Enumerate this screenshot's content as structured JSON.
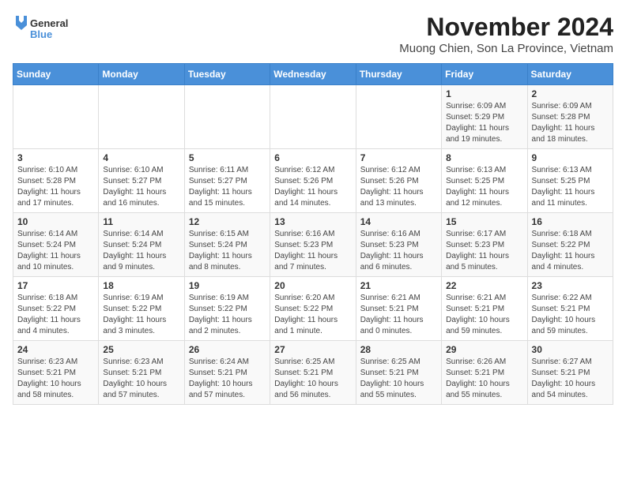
{
  "header": {
    "logo_line1": "General",
    "logo_line2": "Blue",
    "title": "November 2024",
    "subtitle": "Muong Chien, Son La Province, Vietnam"
  },
  "calendar": {
    "days_of_week": [
      "Sunday",
      "Monday",
      "Tuesday",
      "Wednesday",
      "Thursday",
      "Friday",
      "Saturday"
    ],
    "weeks": [
      [
        {
          "day": "",
          "info": ""
        },
        {
          "day": "",
          "info": ""
        },
        {
          "day": "",
          "info": ""
        },
        {
          "day": "",
          "info": ""
        },
        {
          "day": "",
          "info": ""
        },
        {
          "day": "1",
          "info": "Sunrise: 6:09 AM\nSunset: 5:29 PM\nDaylight: 11 hours and 19 minutes."
        },
        {
          "day": "2",
          "info": "Sunrise: 6:09 AM\nSunset: 5:28 PM\nDaylight: 11 hours and 18 minutes."
        }
      ],
      [
        {
          "day": "3",
          "info": "Sunrise: 6:10 AM\nSunset: 5:28 PM\nDaylight: 11 hours and 17 minutes."
        },
        {
          "day": "4",
          "info": "Sunrise: 6:10 AM\nSunset: 5:27 PM\nDaylight: 11 hours and 16 minutes."
        },
        {
          "day": "5",
          "info": "Sunrise: 6:11 AM\nSunset: 5:27 PM\nDaylight: 11 hours and 15 minutes."
        },
        {
          "day": "6",
          "info": "Sunrise: 6:12 AM\nSunset: 5:26 PM\nDaylight: 11 hours and 14 minutes."
        },
        {
          "day": "7",
          "info": "Sunrise: 6:12 AM\nSunset: 5:26 PM\nDaylight: 11 hours and 13 minutes."
        },
        {
          "day": "8",
          "info": "Sunrise: 6:13 AM\nSunset: 5:25 PM\nDaylight: 11 hours and 12 minutes."
        },
        {
          "day": "9",
          "info": "Sunrise: 6:13 AM\nSunset: 5:25 PM\nDaylight: 11 hours and 11 minutes."
        }
      ],
      [
        {
          "day": "10",
          "info": "Sunrise: 6:14 AM\nSunset: 5:24 PM\nDaylight: 11 hours and 10 minutes."
        },
        {
          "day": "11",
          "info": "Sunrise: 6:14 AM\nSunset: 5:24 PM\nDaylight: 11 hours and 9 minutes."
        },
        {
          "day": "12",
          "info": "Sunrise: 6:15 AM\nSunset: 5:24 PM\nDaylight: 11 hours and 8 minutes."
        },
        {
          "day": "13",
          "info": "Sunrise: 6:16 AM\nSunset: 5:23 PM\nDaylight: 11 hours and 7 minutes."
        },
        {
          "day": "14",
          "info": "Sunrise: 6:16 AM\nSunset: 5:23 PM\nDaylight: 11 hours and 6 minutes."
        },
        {
          "day": "15",
          "info": "Sunrise: 6:17 AM\nSunset: 5:23 PM\nDaylight: 11 hours and 5 minutes."
        },
        {
          "day": "16",
          "info": "Sunrise: 6:18 AM\nSunset: 5:22 PM\nDaylight: 11 hours and 4 minutes."
        }
      ],
      [
        {
          "day": "17",
          "info": "Sunrise: 6:18 AM\nSunset: 5:22 PM\nDaylight: 11 hours and 4 minutes."
        },
        {
          "day": "18",
          "info": "Sunrise: 6:19 AM\nSunset: 5:22 PM\nDaylight: 11 hours and 3 minutes."
        },
        {
          "day": "19",
          "info": "Sunrise: 6:19 AM\nSunset: 5:22 PM\nDaylight: 11 hours and 2 minutes."
        },
        {
          "day": "20",
          "info": "Sunrise: 6:20 AM\nSunset: 5:22 PM\nDaylight: 11 hours and 1 minute."
        },
        {
          "day": "21",
          "info": "Sunrise: 6:21 AM\nSunset: 5:21 PM\nDaylight: 11 hours and 0 minutes."
        },
        {
          "day": "22",
          "info": "Sunrise: 6:21 AM\nSunset: 5:21 PM\nDaylight: 10 hours and 59 minutes."
        },
        {
          "day": "23",
          "info": "Sunrise: 6:22 AM\nSunset: 5:21 PM\nDaylight: 10 hours and 59 minutes."
        }
      ],
      [
        {
          "day": "24",
          "info": "Sunrise: 6:23 AM\nSunset: 5:21 PM\nDaylight: 10 hours and 58 minutes."
        },
        {
          "day": "25",
          "info": "Sunrise: 6:23 AM\nSunset: 5:21 PM\nDaylight: 10 hours and 57 minutes."
        },
        {
          "day": "26",
          "info": "Sunrise: 6:24 AM\nSunset: 5:21 PM\nDaylight: 10 hours and 57 minutes."
        },
        {
          "day": "27",
          "info": "Sunrise: 6:25 AM\nSunset: 5:21 PM\nDaylight: 10 hours and 56 minutes."
        },
        {
          "day": "28",
          "info": "Sunrise: 6:25 AM\nSunset: 5:21 PM\nDaylight: 10 hours and 55 minutes."
        },
        {
          "day": "29",
          "info": "Sunrise: 6:26 AM\nSunset: 5:21 PM\nDaylight: 10 hours and 55 minutes."
        },
        {
          "day": "30",
          "info": "Sunrise: 6:27 AM\nSunset: 5:21 PM\nDaylight: 10 hours and 54 minutes."
        }
      ]
    ]
  }
}
